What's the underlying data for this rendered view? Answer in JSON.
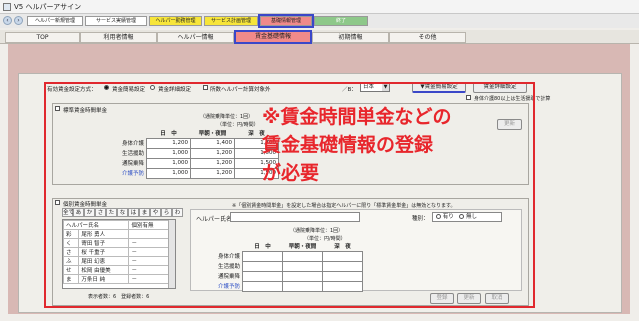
{
  "window": {
    "title": "V5 ヘルパーアサイン"
  },
  "main_tabs": [
    {
      "label": "ヘルパー新規管理",
      "color": "#ffffff"
    },
    {
      "label": "サービス実績管理",
      "color": "#ffffff"
    },
    {
      "label": "ヘルパー勤務管理",
      "color": "#f7e53a"
    },
    {
      "label": "サービス計画管理",
      "color": "#f7e53a"
    },
    {
      "label": "基礎情報管理",
      "color": "#f08a8a"
    },
    {
      "label": "終了",
      "color": "#8ec88a"
    }
  ],
  "sub_tabs": [
    {
      "label": "TOP"
    },
    {
      "label": "利用者情報"
    },
    {
      "label": "ヘルパー情報"
    },
    {
      "label": "賃金基礎情報"
    },
    {
      "label": "初期情報"
    },
    {
      "label": "その他"
    }
  ],
  "method": {
    "label": "有効賃金設定方式：",
    "opt1": "賃金簡易設定",
    "opt2": "賃金詳細設定",
    "excl": "所数ヘルパー計算対象外",
    "basis_label": "／B：",
    "basis_value": "日本",
    "btn_simple": "▼賃金簡易設定",
    "btn_detail": "賃金詳細設定",
    "note": "身体介護80以上は生活援助で計算"
  },
  "standard": {
    "title": "標準賃金時間単金",
    "unit_note": "（通院乗降単位：1回）",
    "unit_note2": "（単位：円/時間）",
    "headers": [
      "日　中",
      "早朝・夜間",
      "深　夜"
    ],
    "rows": [
      {
        "label": "身体介護",
        "v": [
          "1,200",
          "1,400",
          "1,700"
        ]
      },
      {
        "label": "生活援助",
        "v": [
          "1,000",
          "1,200",
          "1,500"
        ]
      },
      {
        "label": "通院乗降",
        "v": [
          "1,000",
          "1,200",
          "1,500"
        ]
      },
      {
        "label": "介護予防",
        "v": [
          "1,000",
          "1,200",
          "1,500"
        ]
      }
    ],
    "update_btn": "更新"
  },
  "individual": {
    "title": "個別賃金時間単金",
    "kana": [
      "全て",
      "あ",
      "か",
      "さ",
      "た",
      "な",
      "は",
      "ま",
      "や",
      "ら",
      "わ"
    ],
    "col_name": "ヘルパー氏名",
    "col_flag": "個別有無",
    "helpers": [
      {
        "code": "彩",
        "name": "尾形 勇人",
        "flag": ""
      },
      {
        "code": "く",
        "name": "寄田 智子",
        "flag": "－"
      },
      {
        "code": "さ",
        "name": "桜 千重子",
        "flag": "－"
      },
      {
        "code": "ふ",
        "name": "尾田 幻恵",
        "flag": "－"
      },
      {
        "code": "せ",
        "name": "松岡 由優美",
        "flag": "－"
      },
      {
        "code": "ま",
        "name": "万条日 純",
        "flag": "－"
      }
    ],
    "count_text": "表示者数：6　登録者数：6",
    "notice": "※「個別賃金時間単金」を設定した場合は指定ヘルパーに限り「標準賃金単金」は無効となります。",
    "name_label": "ヘルパー氏名",
    "kind_label": "種別：",
    "kind_yes": "有り",
    "kind_no": "無し",
    "unit_note": "（通院乗降単位：1回）",
    "unit_note2": "（単位：円/時間）",
    "headers": [
      "日　中",
      "早朝・夜間",
      "深　夜"
    ],
    "rows": [
      "身体介護",
      "生活援助",
      "通院乗降",
      "介護予防"
    ],
    "btn_register": "登録",
    "btn_update": "更新",
    "btn_cancel": "取消"
  },
  "annotation": [
    "※賃金時間単金などの",
    "賃金基礎情報の登録",
    "が必要"
  ]
}
